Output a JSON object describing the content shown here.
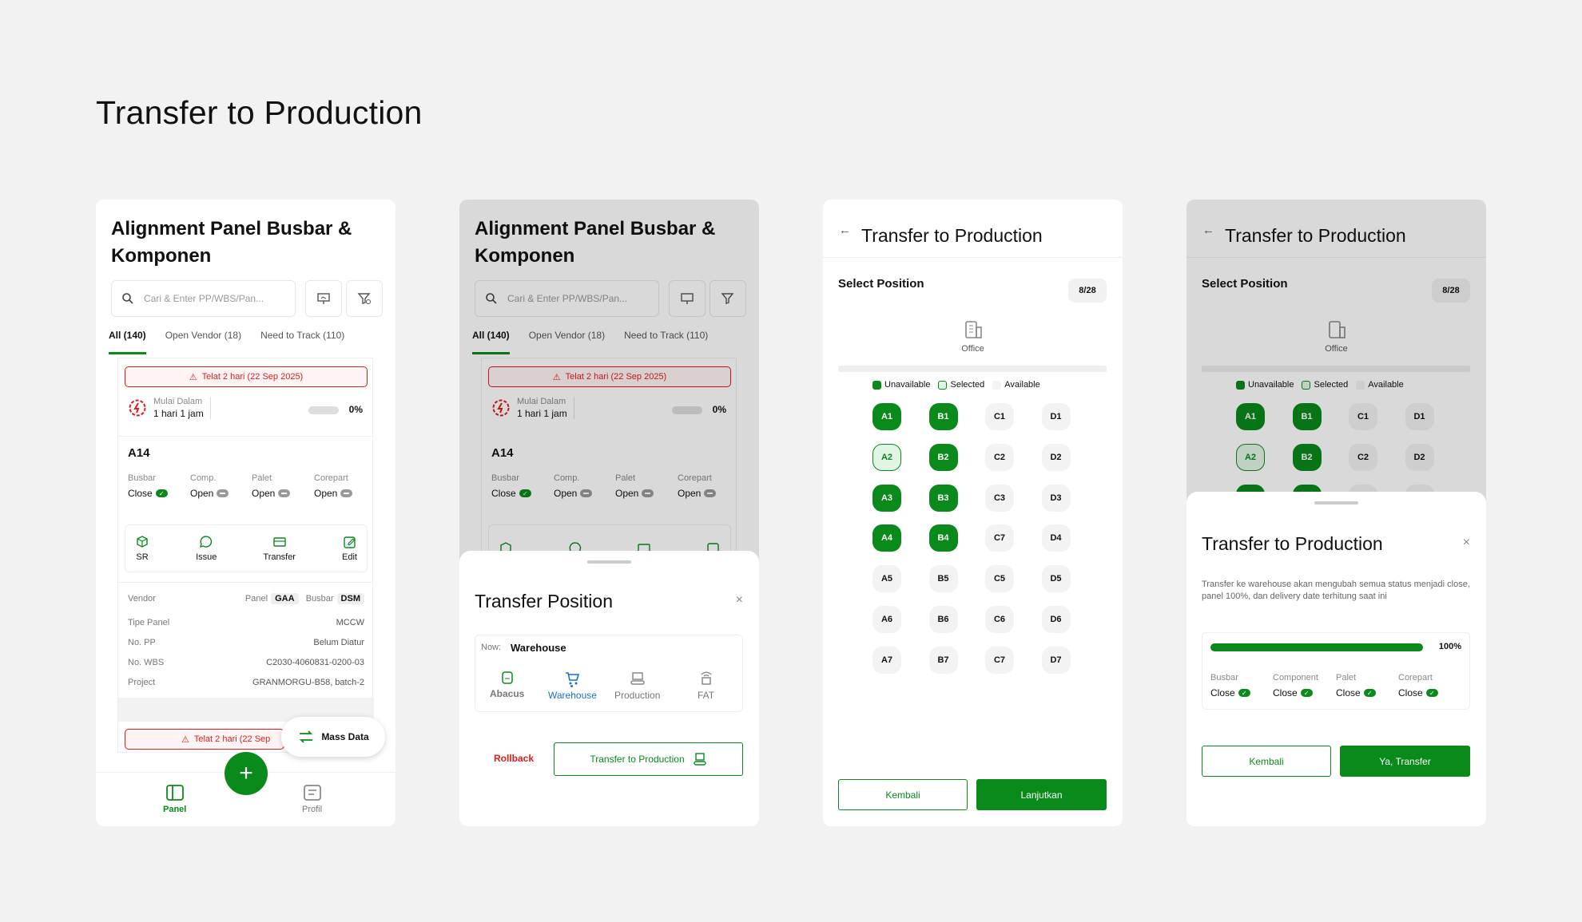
{
  "page": {
    "title": "Transfer to Production"
  },
  "panel_list": {
    "title": "Alignment Panel Busbar & Komponen",
    "search_placeholder": "Cari & Enter PP/WBS/Pan...",
    "tabs": [
      "All (140)",
      "Open Vendor (18)",
      "Need to Track (110)"
    ],
    "card": {
      "late_text": "Telat 2 hari (22 Sep 2025)",
      "start_label": "Mulai Dalam",
      "start_value": "1 hari 1 jam",
      "progress": "0%",
      "code": "A14",
      "statuses": [
        {
          "label": "Busbar",
          "value": "Close"
        },
        {
          "label": "Comp.",
          "value": "Open"
        },
        {
          "label": "Palet",
          "value": "Open"
        },
        {
          "label": "Corepart",
          "value": "Open"
        }
      ],
      "actions": [
        "SR",
        "Issue",
        "Transfer",
        "Edit"
      ],
      "vendor_label": "Vendor",
      "vendor_panel_label": "Panel",
      "vendor_panel_value": "GAA",
      "vendor_busbar_label": "Busbar",
      "vendor_busbar_value": "DSM",
      "details": [
        {
          "k": "Tipe Panel",
          "v": "MCCW"
        },
        {
          "k": "No. PP",
          "v": "Belum Diatur"
        },
        {
          "k": "No. WBS",
          "v": "C2030-4060831-0200-03"
        },
        {
          "k": "Project",
          "v": "GRANMORGU-B58, batch-2"
        }
      ]
    },
    "card2_late_text": "Telat 2 hari (22 Sep",
    "card2_start_label": "Mulai Dalam",
    "mass_data": "Mass Data",
    "fab": "+",
    "nav": [
      "Panel",
      "Profil"
    ]
  },
  "transfer_position": {
    "title": "Transfer Position",
    "close": "×",
    "now_label": "Now:",
    "now_value": "Warehouse",
    "stages": [
      "Abacus",
      "Warehouse",
      "Production",
      "FAT"
    ],
    "rollback": "Rollback",
    "transfer_button": "Transfer to Production"
  },
  "select_position": {
    "back": "←",
    "title": "Transfer to Production",
    "section": "Select Position",
    "count": "8/28",
    "office": "Office",
    "legend": [
      "Unavailable",
      "Selected",
      "Available"
    ],
    "seats": [
      {
        "id": "A1",
        "state": "u"
      },
      {
        "id": "B1",
        "state": "u"
      },
      {
        "id": "C1",
        "state": "a"
      },
      {
        "id": "D1",
        "state": "a"
      },
      {
        "id": "A2",
        "state": "s"
      },
      {
        "id": "B2",
        "state": "u"
      },
      {
        "id": "C2",
        "state": "a"
      },
      {
        "id": "D2",
        "state": "a"
      },
      {
        "id": "A3",
        "state": "u"
      },
      {
        "id": "B3",
        "state": "u"
      },
      {
        "id": "C3",
        "state": "a"
      },
      {
        "id": "D3",
        "state": "a"
      },
      {
        "id": "A4",
        "state": "u"
      },
      {
        "id": "B4",
        "state": "u"
      },
      {
        "id": "C7",
        "state": "a"
      },
      {
        "id": "D4",
        "state": "a"
      },
      {
        "id": "A5",
        "state": "a"
      },
      {
        "id": "B5",
        "state": "a"
      },
      {
        "id": "C5",
        "state": "a"
      },
      {
        "id": "D5",
        "state": "a"
      },
      {
        "id": "A6",
        "state": "a"
      },
      {
        "id": "B6",
        "state": "a"
      },
      {
        "id": "C6",
        "state": "a"
      },
      {
        "id": "D6",
        "state": "a"
      },
      {
        "id": "A7",
        "state": "a"
      },
      {
        "id": "B7",
        "state": "a"
      },
      {
        "id": "C7",
        "state": "a"
      },
      {
        "id": "D7",
        "state": "a"
      }
    ],
    "back_button": "Kembali",
    "next_button": "Lanjutkan"
  },
  "confirm": {
    "title": "Transfer to Production",
    "close": "×",
    "description": "Transfer ke warehouse akan mengubah semua status menjadi close, panel 100%, dan delivery date terhitung saat ini",
    "progress": "100%",
    "progress_value": 1.0,
    "statuses": [
      {
        "label": "Busbar",
        "value": "Close"
      },
      {
        "label": "Component",
        "value": "Close"
      },
      {
        "label": "Palet",
        "value": "Close"
      },
      {
        "label": "Corepart",
        "value": "Close"
      }
    ],
    "back_button": "Kembali",
    "confirm_button": "Ya, Transfer"
  },
  "colors": {
    "accent": "#098a1b",
    "danger": "#e01d1d",
    "active_stage": "#1a6fd8"
  }
}
